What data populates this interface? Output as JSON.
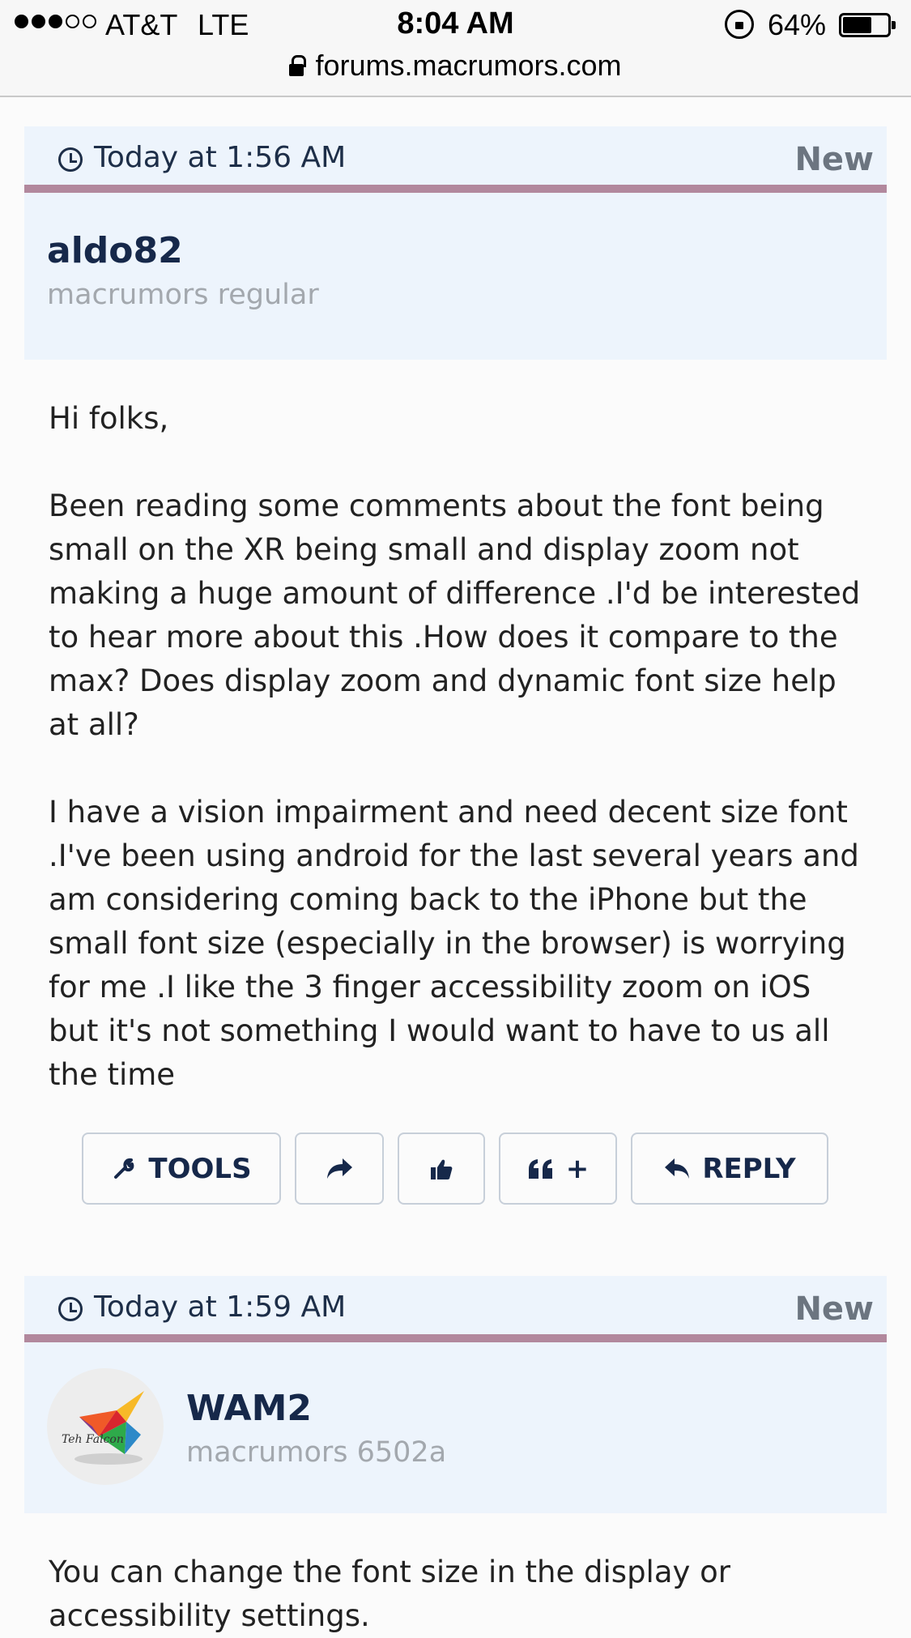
{
  "status_bar": {
    "carrier": "AT&T",
    "network": "LTE",
    "time": "8:04 AM",
    "battery_percent": "64%",
    "battery_level": 0.64,
    "signal_bars_filled": 3,
    "signal_bars_total": 5
  },
  "url_bar": {
    "domain": "forums.macrumors.com"
  },
  "posts": [
    {
      "date": "Today at 1:56 AM",
      "badge": "New",
      "author": "aldo82",
      "author_title": "macrumors regular",
      "body": "Hi folks,\n\nBeen reading some comments about the font being small on the XR being small and display zoom not making a huge amount of difference .I'd be interested to hear more about this .How does it compare to the max? Does display zoom and dynamic font size help at all?\n\nI have a vision impairment and need decent size font .I've been using android for the last several years and am considering coming back to the iPhone but the small font size (especially in the browser) is worrying for me .I like the 3 finger accessibility zoom on iOS but it's not something I would want to have to us all the time"
    },
    {
      "date": "Today at 1:59 AM",
      "badge": "New",
      "author": "WAM2",
      "author_title": "macrumors 6502a",
      "avatar_caption": "Teh Falcon",
      "body": "You can change the font size in the display or accessibility settings."
    }
  ],
  "actions": {
    "tools": "TOOLS",
    "quote": "+",
    "reply": "REPLY"
  },
  "colors": {
    "header_bg": "#edf4fc",
    "date_bar_border": "#b2889d",
    "author_name": "#16284a",
    "author_title": "#a3a8ae",
    "button_border": "#c7cfd9"
  }
}
